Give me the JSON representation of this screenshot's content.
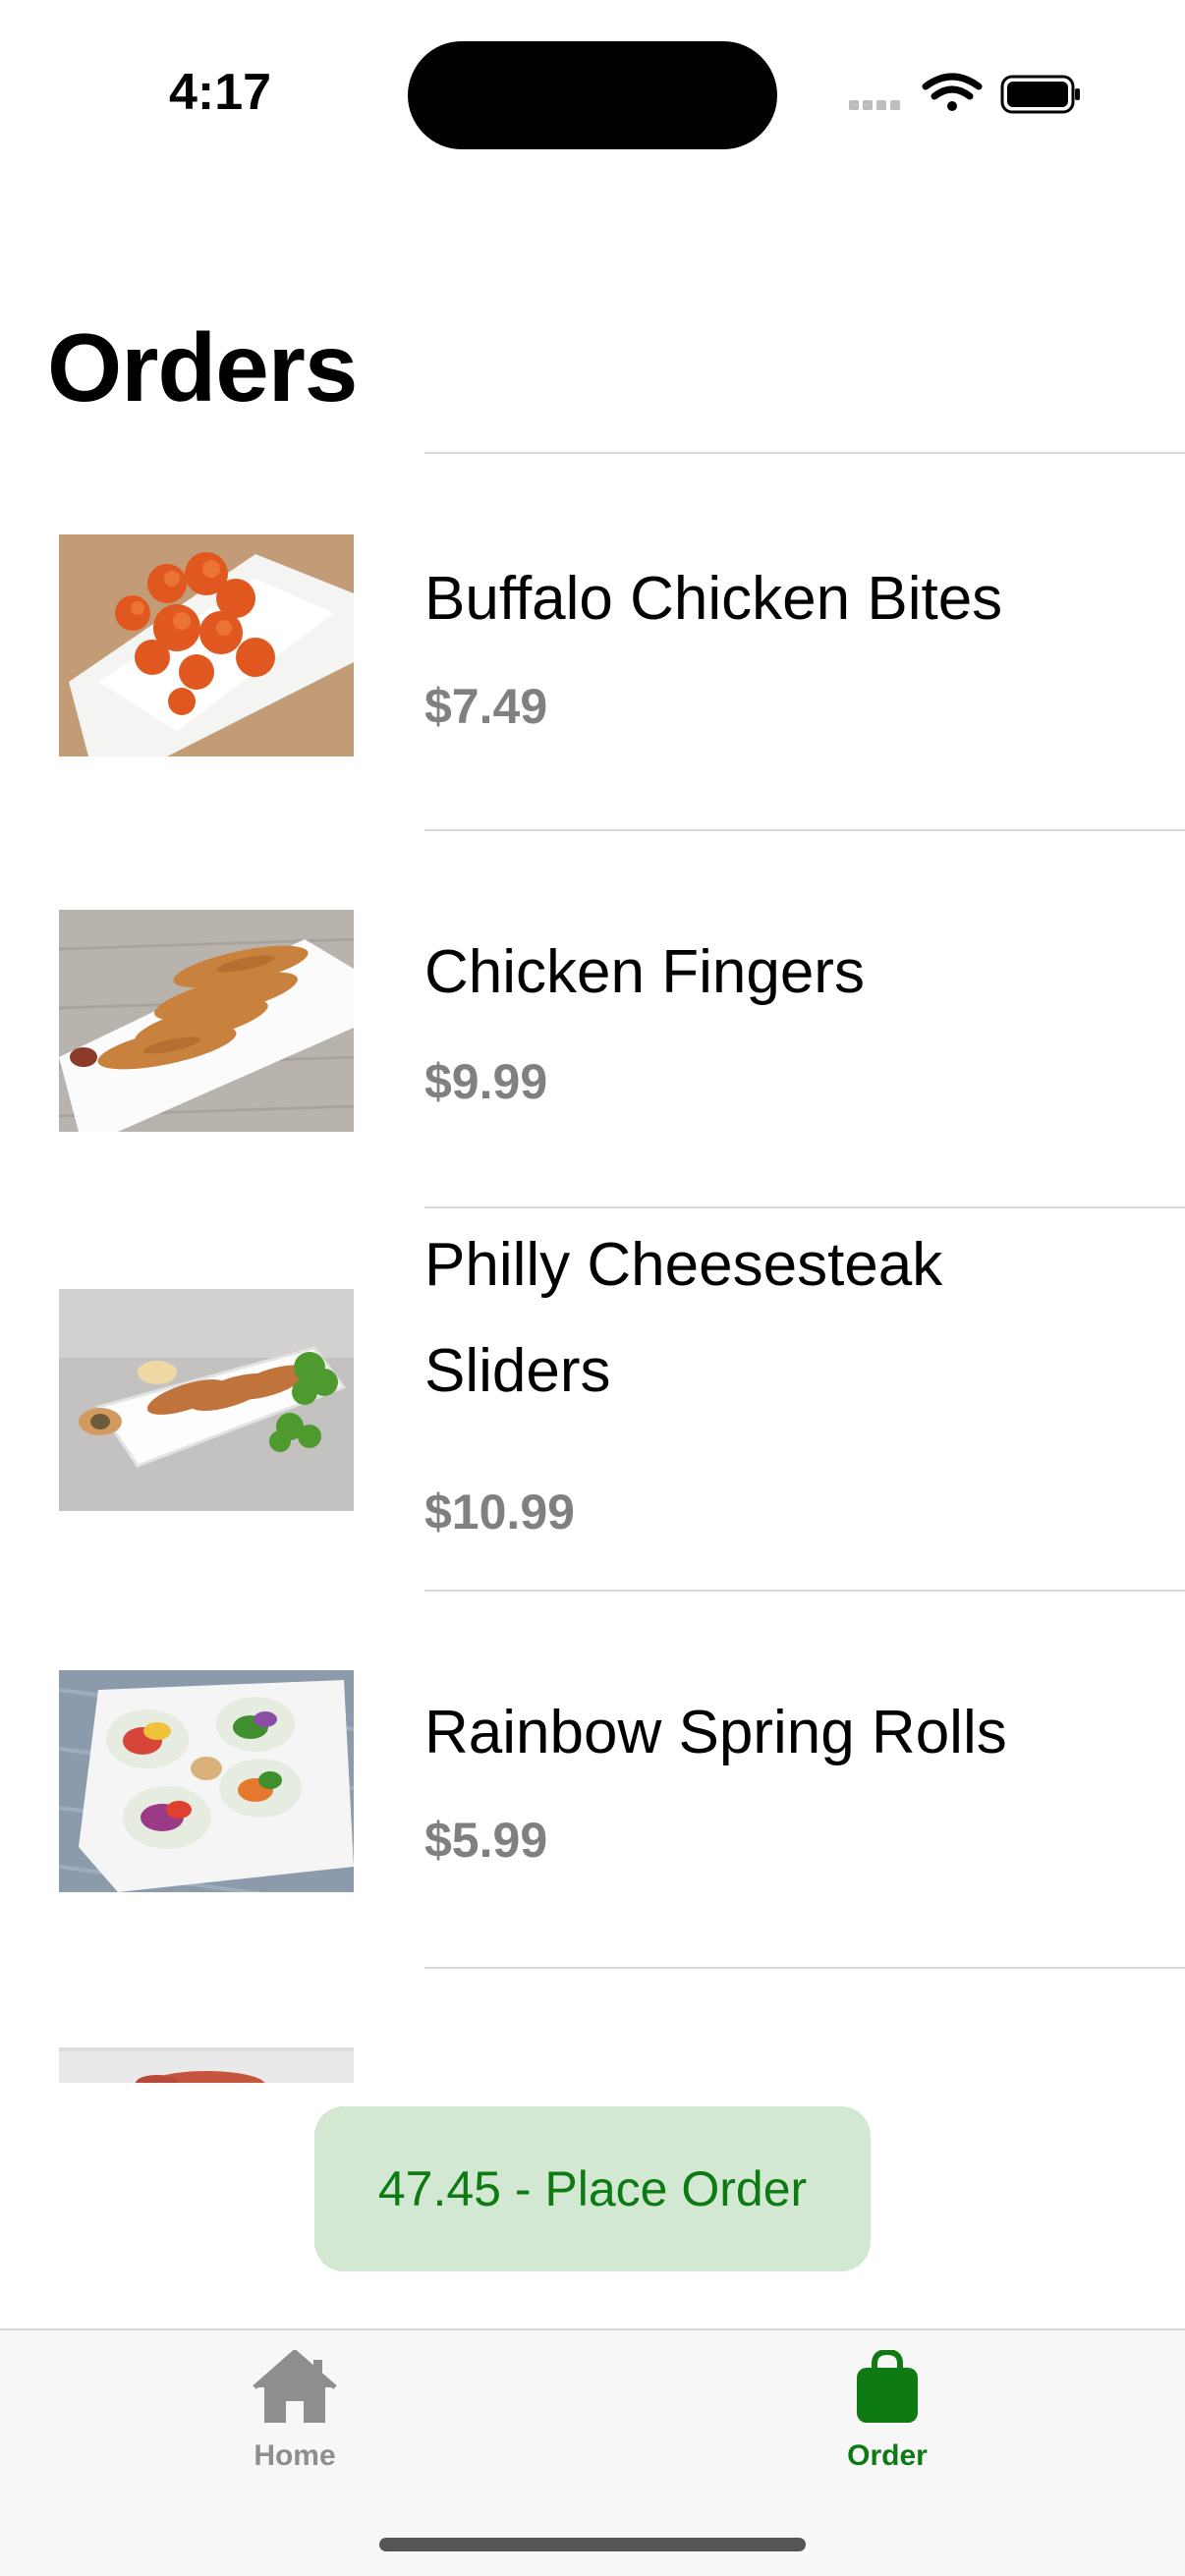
{
  "status_bar": {
    "time": "4:17"
  },
  "page": {
    "title": "Orders"
  },
  "orders": [
    {
      "name": "Buffalo Chicken Bites",
      "price": "$7.49",
      "image": "buffalo-chicken-bites-photo"
    },
    {
      "name": "Chicken Fingers",
      "price": "$9.99",
      "image": "chicken-fingers-photo"
    },
    {
      "name": "Philly Cheesesteak Sliders",
      "price": "$10.99",
      "image": "philly-cheesesteak-sliders-photo"
    },
    {
      "name": "Rainbow Spring Rolls",
      "price": "$5.99",
      "image": "rainbow-spring-rolls-photo"
    }
  ],
  "place_order_button": {
    "label": "47.45 - Place Order"
  },
  "tab_bar": {
    "tabs": [
      {
        "label": "Home",
        "icon": "house-icon",
        "selected": false
      },
      {
        "label": "Order",
        "icon": "bag-icon",
        "selected": true
      }
    ]
  },
  "colors": {
    "accent": "#0d7a13",
    "button_bg": "#d2e8d2",
    "price_gray": "#808080",
    "tab_inactive": "#8e8e8e"
  }
}
